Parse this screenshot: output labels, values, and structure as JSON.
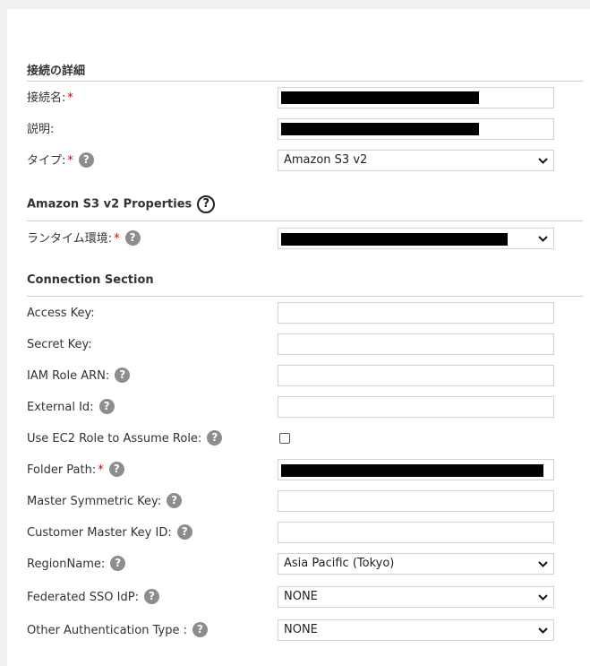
{
  "details": {
    "title": "接続の詳細",
    "name_label": "接続名:",
    "description_label": "説明:",
    "type_label": "タイプ:",
    "type_value": "Amazon S3 v2"
  },
  "properties": {
    "title": "Amazon S3 v2 Properties",
    "runtime_label": "ランタイム環境:"
  },
  "connection": {
    "title": "Connection Section",
    "access_key_label": "Access Key:",
    "secret_key_label": "Secret Key:",
    "iam_role_label": "IAM Role ARN:",
    "external_id_label": "External Id:",
    "use_ec2_label": "Use EC2 Role to Assume Role:",
    "folder_path_label": "Folder Path:",
    "master_key_label": "Master Symmetric Key:",
    "customer_key_label": "Customer Master Key ID:",
    "region_label": "RegionName:",
    "region_value": "Asia Pacific (Tokyo)",
    "sso_label": "Federated SSO IdP:",
    "sso_value": "NONE",
    "other_auth_label": "Other Authentication Type :",
    "other_auth_value": "NONE"
  },
  "required_mark": "*",
  "help_glyph": "?",
  "icons": {
    "help": "help-icon",
    "dropdown": "chevron-down-icon"
  }
}
